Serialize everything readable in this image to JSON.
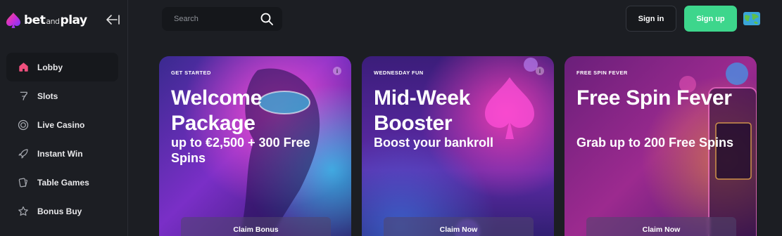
{
  "brand": {
    "logo_bet": "bet",
    "logo_and": "and",
    "logo_play": "play"
  },
  "search": {
    "placeholder": "Search"
  },
  "header": {
    "signin_label": "Sign in",
    "signup_label": "Sign up"
  },
  "sidebar": {
    "items": [
      {
        "label": "Lobby",
        "icon": "home-icon",
        "active": true
      },
      {
        "label": "Slots",
        "icon": "slots-seven-icon",
        "active": false
      },
      {
        "label": "Live Casino",
        "icon": "live-casino-chip-icon",
        "active": false
      },
      {
        "label": "Instant Win",
        "icon": "rocket-icon",
        "active": false
      },
      {
        "label": "Table Games",
        "icon": "cards-icon",
        "active": false
      },
      {
        "label": "Bonus Buy",
        "icon": "star-icon",
        "active": false
      }
    ]
  },
  "promos": [
    {
      "eyebrow": "GET STARTED",
      "title": "Welcome Package",
      "subtitle": "up to €2,500 + 300 Free Spins",
      "cta": "Claim Bonus"
    },
    {
      "eyebrow": "WEDNESDAY FUN",
      "title": "Mid-Week Booster",
      "subtitle": "Boost your bankroll",
      "cta": "Claim Now"
    },
    {
      "eyebrow": "FREE SPIN FEVER",
      "title": "Free Spin Fever",
      "subtitle": "Grab up to 200 Free Spins",
      "cta": "Claim Now"
    }
  ],
  "colors": {
    "accent_green": "#3dd68c",
    "brand_pink": "#e8336f",
    "background": "#1c1e23"
  }
}
